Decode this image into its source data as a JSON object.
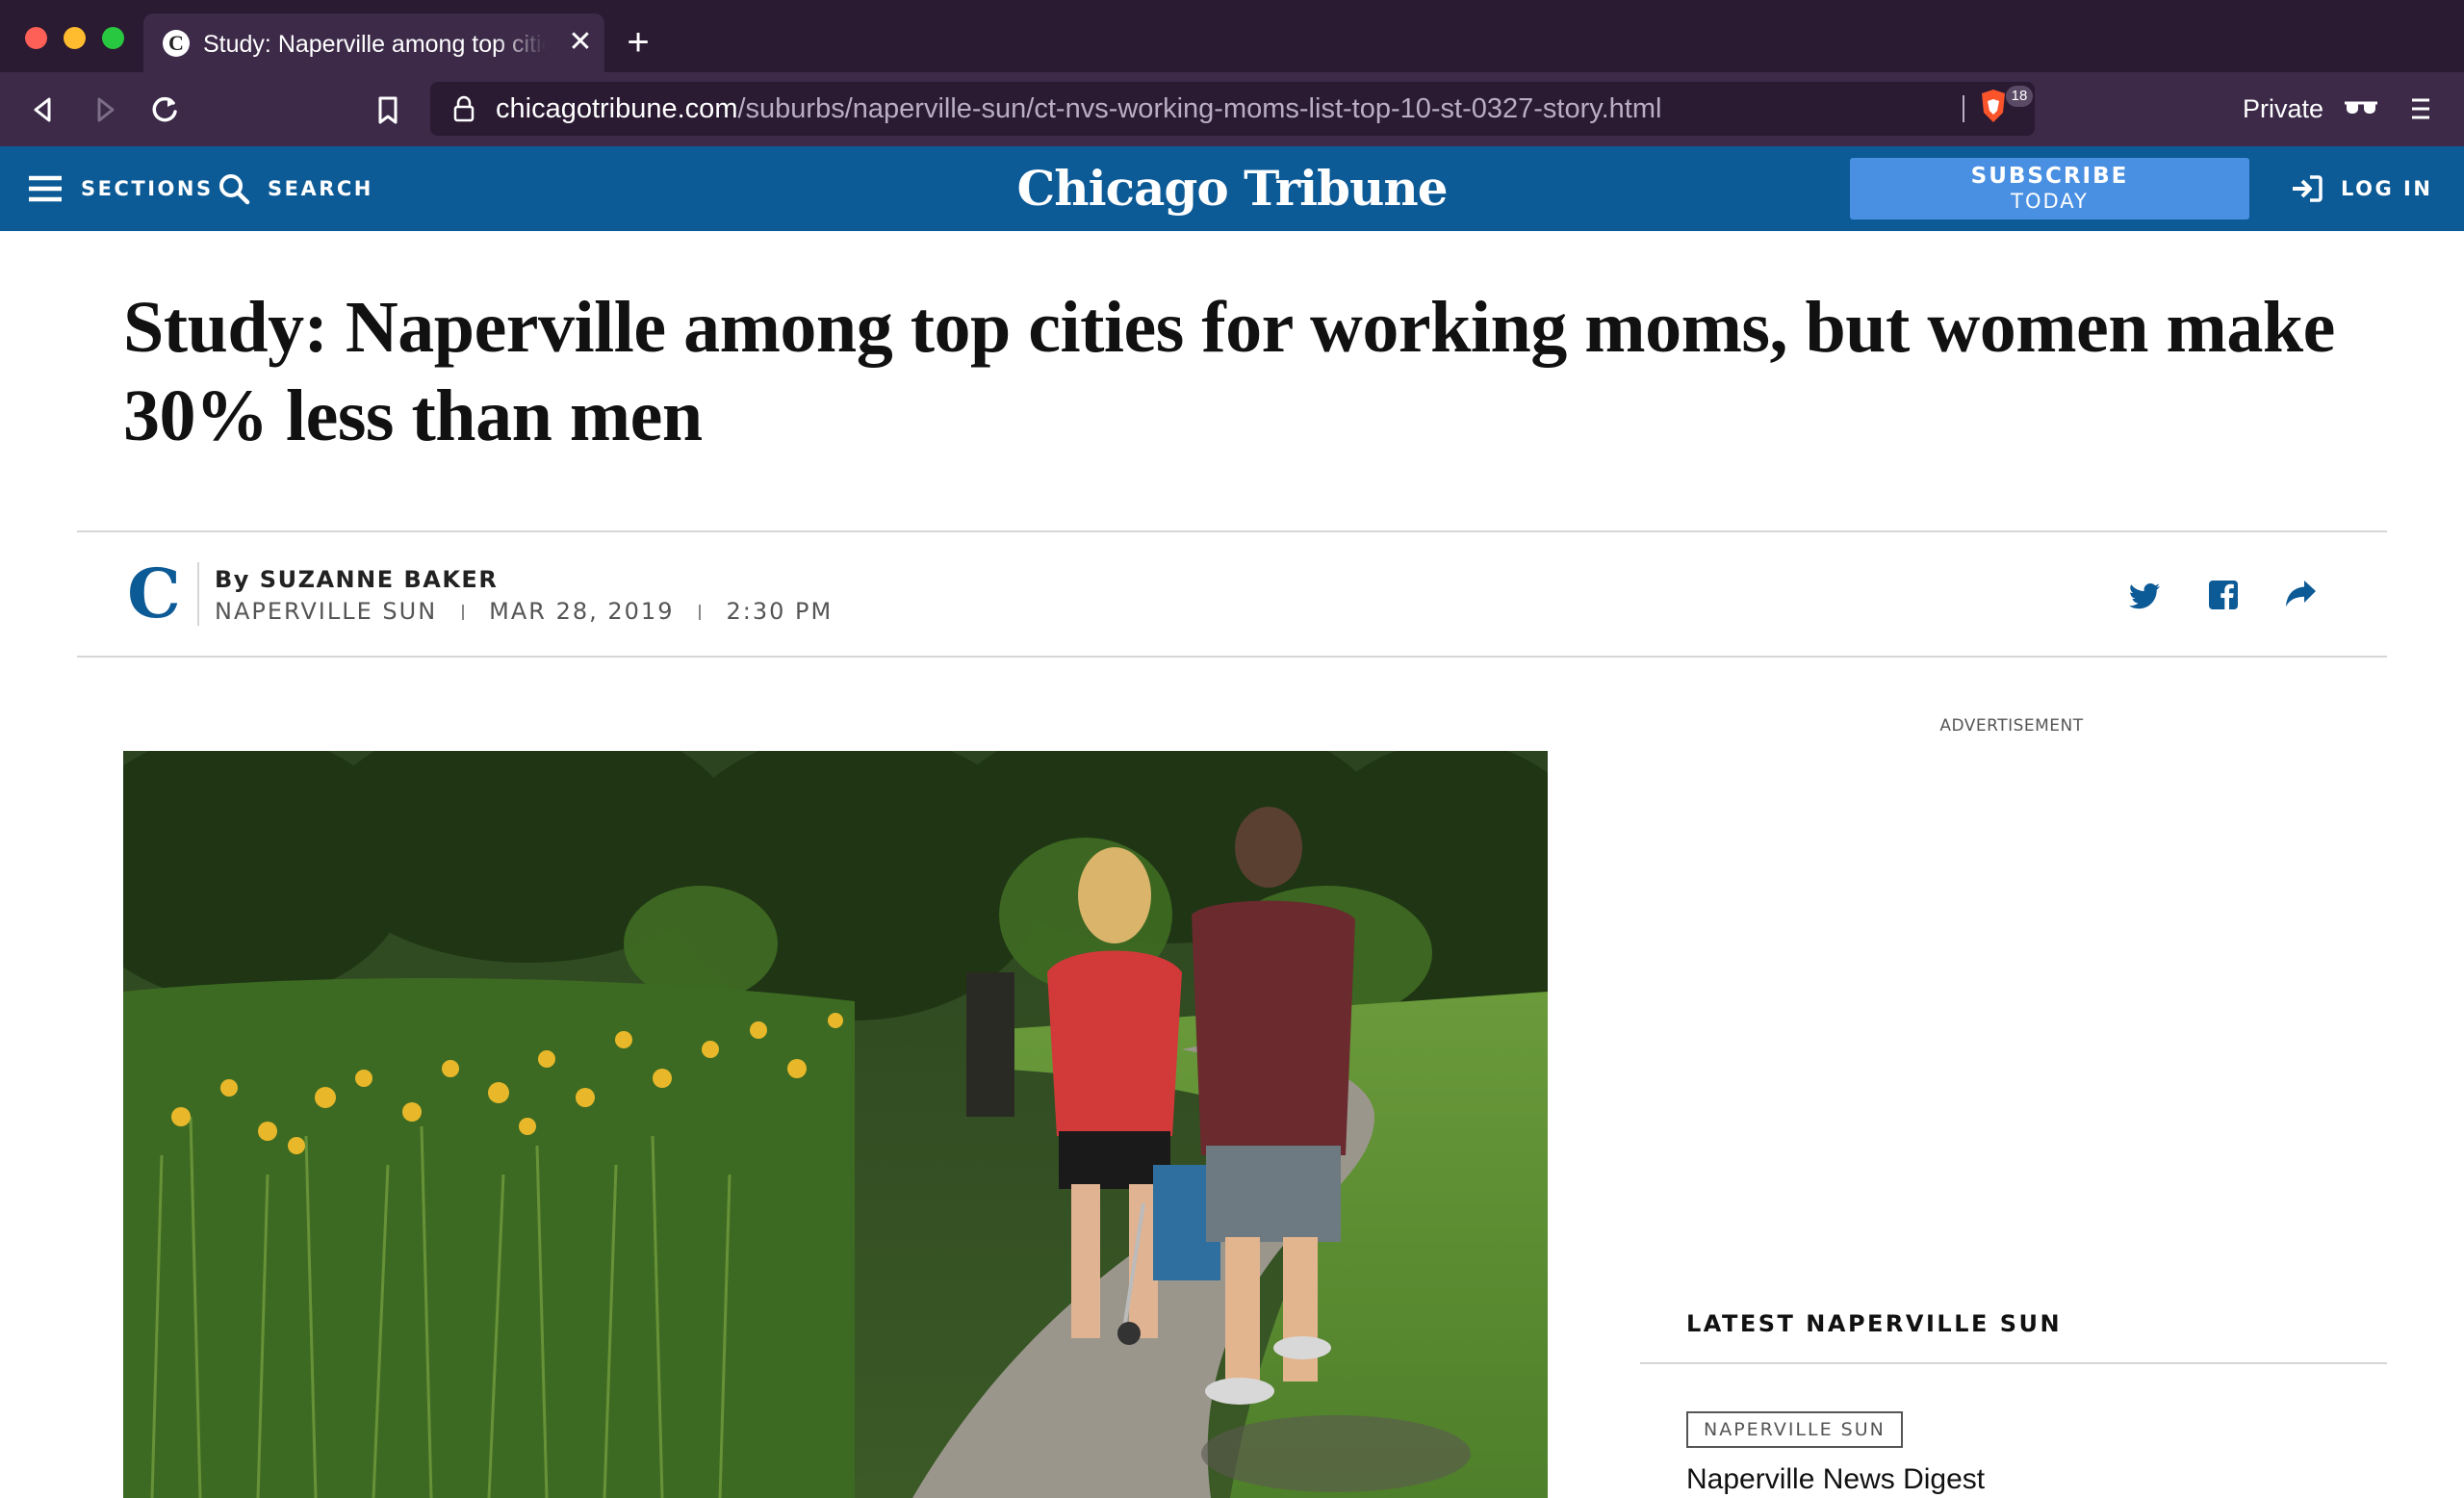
{
  "browser": {
    "tab_title": "Study: Naperville among top cities for working moms, but women make 30% less than men",
    "tab_favicon": "C",
    "close_glyph": "✕",
    "new_tab_glyph": "+",
    "url_host": "chicagotribune.com",
    "url_path": "/suburbs/naperville-sun/ct-nvs-working-moms-list-top-10-st-0327-story.html",
    "shield_count": "18",
    "private_label": "Private",
    "icons": [
      "back-icon",
      "forward-icon",
      "reload-icon",
      "bookmark-icon",
      "lock-icon",
      "brave-shield-icon",
      "private-glasses-icon",
      "menu-icon"
    ],
    "colors": {
      "tabbar": "#2a1a32",
      "toolbar": "#3c2a48"
    }
  },
  "site_header": {
    "sections_label": "SECTIONS",
    "search_label": "SEARCH",
    "logo_text": "Chicago Tribune",
    "subscribe_line1": "SUBSCRIBE",
    "subscribe_line2": "TODAY",
    "login_label": "LOG IN",
    "colors": {
      "background": "#0c5a96",
      "subscribe": "#4a90e2"
    }
  },
  "article": {
    "headline": "Study: Naperville among top cities for working moms, but women make 30% less than men",
    "byline_logo": "C",
    "byline_prefix": "By ",
    "author": "SUZANNE BAKER",
    "publication": "NAPERVILLE SUN",
    "date": "MAR 28, 2019",
    "time": "2:30 PM",
    "share": [
      "twitter-icon",
      "facebook-icon",
      "share-arrow-icon"
    ]
  },
  "sidebar": {
    "ad_label": "ADVERTISEMENT",
    "latest_title": "LATEST NAPERVILLE SUN",
    "latest_tag": "NAPERVILLE SUN",
    "latest_item": "Naperville News Digest"
  }
}
